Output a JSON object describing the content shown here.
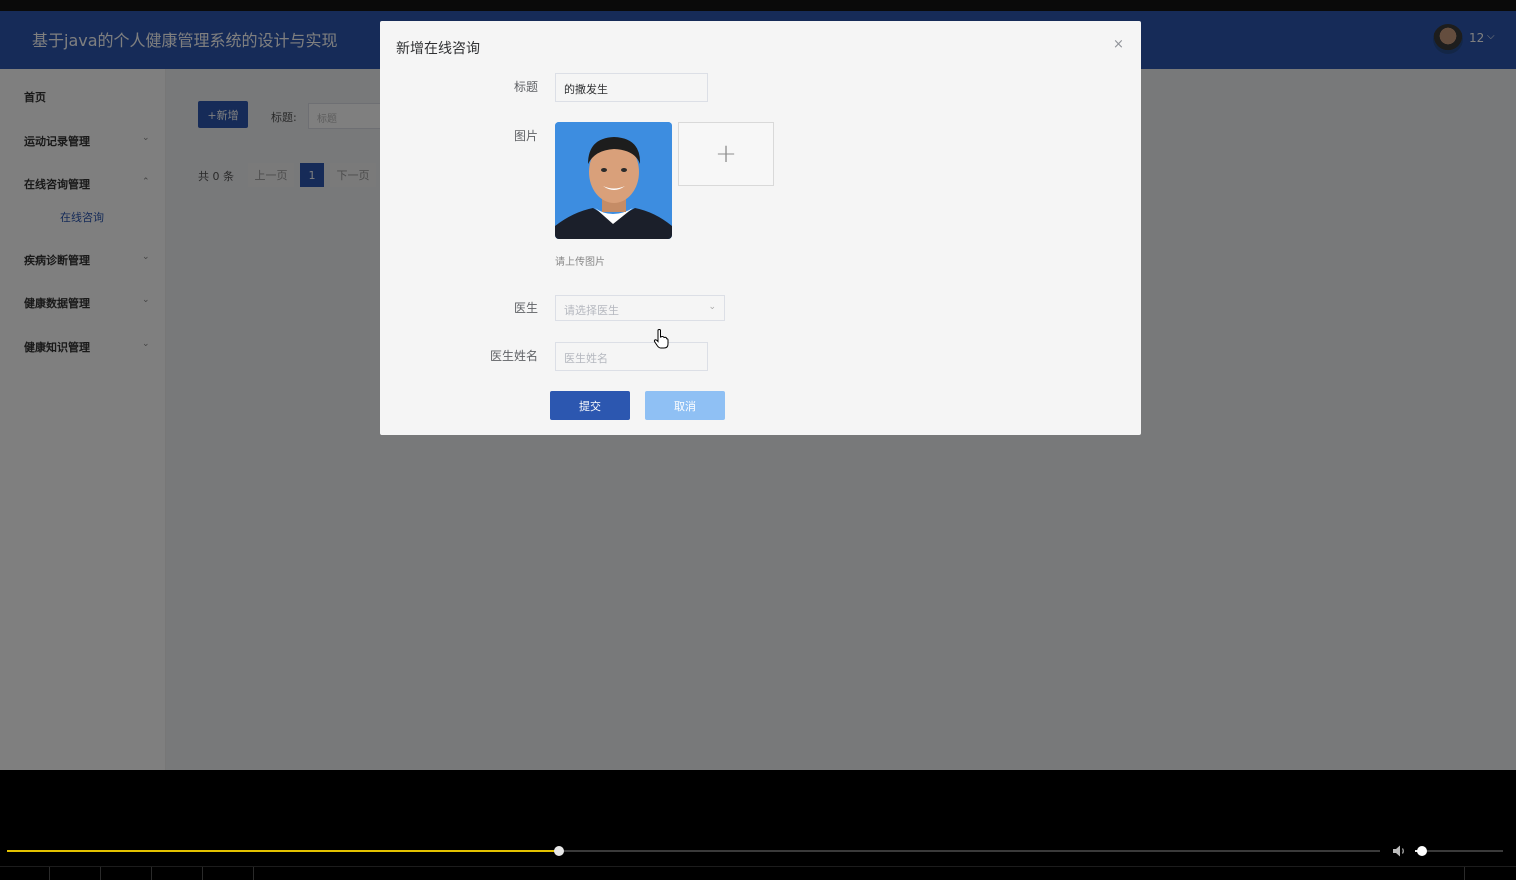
{
  "app": {
    "title": "基于java的个人健康管理系统的设计与实现",
    "user": {
      "name": "12",
      "caret": "⌵"
    }
  },
  "sidebar": {
    "items": [
      {
        "label": "首页",
        "caret": ""
      },
      {
        "label": "运动记录管理",
        "caret": "⌄"
      },
      {
        "label": "在线咨询管理",
        "caret": "⌃"
      },
      {
        "label": "疾病诊断管理",
        "caret": "⌄"
      },
      {
        "label": "健康数据管理",
        "caret": "⌄"
      },
      {
        "label": "健康知识管理",
        "caret": "⌄"
      }
    ],
    "submenu": {
      "label": "在线咨询"
    }
  },
  "toolbar": {
    "add_label": "+新增",
    "filter_label": "标题:",
    "filter_placeholder": "标题"
  },
  "pager": {
    "total": "共 0 条",
    "prev": "上一页",
    "current": "1",
    "next": "下一页"
  },
  "dialog": {
    "title": "新增在线咨询",
    "close": "×",
    "fields": {
      "title_label": "标题",
      "title_value": "的撒发生",
      "image_label": "图片",
      "upload_plus": "+",
      "upload_tip": "请上传图片",
      "doctor_label": "医生",
      "doctor_placeholder": "请选择医生",
      "doctor_caret": "⌄",
      "doctor_name_label": "医生姓名",
      "doctor_name_placeholder": "医生姓名"
    },
    "buttons": {
      "submit": "提交",
      "cancel": "取消"
    }
  },
  "player": {
    "progress": 0.402,
    "volume": 0.08
  },
  "colors": {
    "primary": "#2c57b0",
    "cancel": "#8fc0f4",
    "seek": "#e3c200"
  }
}
